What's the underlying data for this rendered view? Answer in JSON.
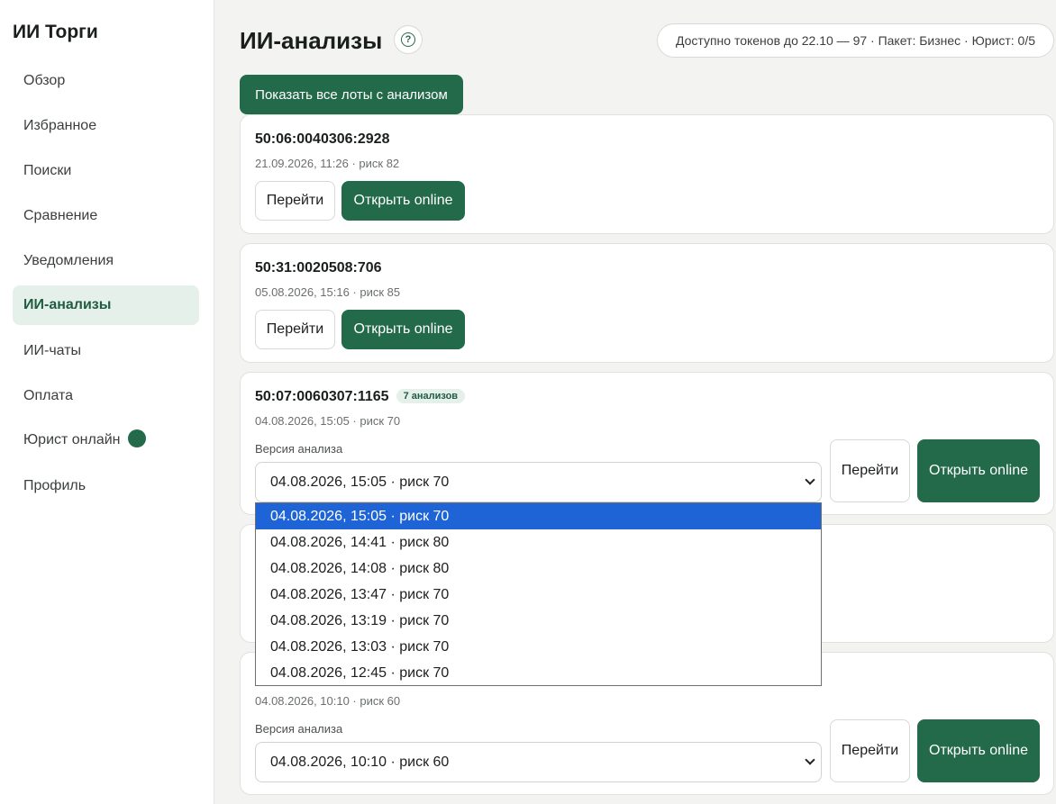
{
  "sidebar": {
    "brand": "ИИ Торги",
    "items": [
      {
        "label": "Обзор"
      },
      {
        "label": "Избранное"
      },
      {
        "label": "Поиски"
      },
      {
        "label": "Сравнение"
      },
      {
        "label": "Уведомления"
      },
      {
        "label": "ИИ-анализы",
        "active": true
      },
      {
        "label": "ИИ-чаты"
      },
      {
        "label": "Оплата"
      },
      {
        "label": "Юрист онлайн"
      },
      {
        "label": "Профиль"
      }
    ]
  },
  "header": {
    "title": "ИИ-анализы",
    "help_icon": "?",
    "tokens_info": "Доступно токенов до 22.10 — 97 · Пакет: Бизнес · Юрист: 0/5"
  },
  "show_all_label": "Показать все лоты с анализом",
  "common": {
    "go_label": "Перейти",
    "open_online_label": "Открыть online",
    "version_label": "Версия анализа"
  },
  "cards": [
    {
      "title": "50:06:0040306:2928",
      "meta": "21.09.2026, 11:26 · риск 82"
    },
    {
      "title": "50:31:0020508:706",
      "meta": "05.08.2026, 15:16 · риск 85"
    },
    {
      "title": "50:07:0060307:1165",
      "badge": "7 анализов",
      "meta": "04.08.2026, 15:05 · риск 70",
      "selected_version": "04.08.2026, 15:05 · риск 70"
    },
    {
      "meta": "04.08.2026, 10:10 · риск 60",
      "selected_version": "04.08.2026, 10:10 · риск 60"
    }
  ],
  "dropdown": {
    "options": [
      "04.08.2026, 15:05 · риск 70",
      "04.08.2026, 14:41 · риск 80",
      "04.08.2026, 14:08 · риск 80",
      "04.08.2026, 13:47 · риск 70",
      "04.08.2026, 13:19 · риск 70",
      "04.08.2026, 13:03 · риск 70",
      "04.08.2026, 12:45 · риск 70"
    ],
    "selected_index": 0
  }
}
